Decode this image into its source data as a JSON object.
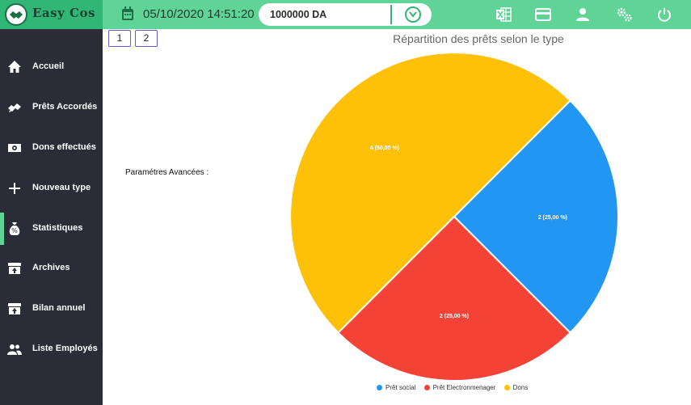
{
  "header": {
    "logo": "Easy Cos",
    "datetime": "05/10/2020 14:51:20",
    "balance": "1000000 DA",
    "icons": [
      "excel-icon",
      "card-icon",
      "user-icon",
      "settings-icon",
      "power-icon"
    ]
  },
  "sidebar": {
    "items": [
      {
        "label": "Accueil",
        "icon": "home-icon"
      },
      {
        "label": "Prêts Accordés",
        "icon": "handshake-icon"
      },
      {
        "label": "Dons effectués",
        "icon": "cash-icon"
      },
      {
        "label": "Nouveau type",
        "icon": "plus-icon"
      },
      {
        "label": "Statistiques",
        "icon": "money-bag-icon",
        "active": true
      },
      {
        "label": "Archives",
        "icon": "archive-icon"
      },
      {
        "label": "Bilan annuel",
        "icon": "archive-upload-icon"
      },
      {
        "label": "Liste Employés",
        "icon": "people-icon"
      }
    ]
  },
  "pagination": [
    "1",
    "2"
  ],
  "params_label": "Paramétres Avancées :",
  "chart_data": {
    "type": "pie",
    "title": "Répartition des prêts selon le type",
    "series": [
      {
        "name": "Prêt social",
        "value": 2,
        "label": "2 (25,00 %)",
        "color": "#2196f3"
      },
      {
        "name": "Prêt Electronmenager",
        "value": 2,
        "label": "2 (25,00 %)",
        "color": "#f44336"
      },
      {
        "name": "Dons",
        "value": 4,
        "label": "4 (50,00 %)",
        "color": "#ffc107"
      }
    ],
    "legend_position": "bottom"
  }
}
